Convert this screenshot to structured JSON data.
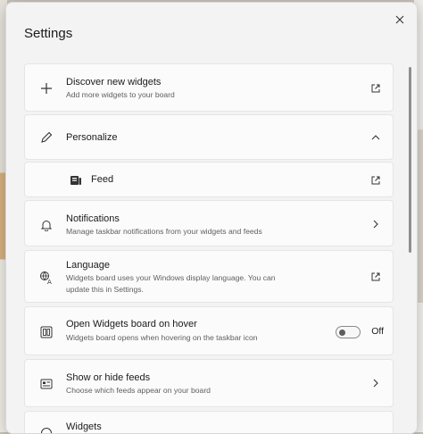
{
  "dialog": {
    "title": "Settings"
  },
  "items": [
    {
      "title": "Discover new widgets",
      "subtitle": "Add more widgets to your board",
      "icon": "plus-icon",
      "trail": "open-external-icon"
    },
    {
      "title": "Personalize",
      "icon": "pencil-icon",
      "trail": "chevron-up-icon"
    },
    {
      "title": "Feed",
      "icon": "feed-icon",
      "trail": "open-external-icon"
    },
    {
      "title": "Notifications",
      "subtitle": "Manage taskbar notifications from your widgets and feeds",
      "icon": "bell-icon",
      "trail": "chevron-right-icon"
    },
    {
      "title": "Language",
      "subtitle_lines": [
        "Widgets board uses your Windows display language. You can",
        "update this in Settings."
      ],
      "icon": "language-icon",
      "trail": "open-external-icon"
    },
    {
      "title": "Open Widgets board on hover",
      "subtitle": "Widgets board opens when hovering on the taskbar icon",
      "icon": "widget-board-icon",
      "toggle_state": "Off"
    },
    {
      "title": "Show or hide feeds",
      "subtitle": "Choose which feeds appear on your board",
      "icon": "feeds-icon",
      "trail": "chevron-right-icon"
    },
    {
      "title": "Widgets",
      "icon": "info-icon"
    }
  ]
}
